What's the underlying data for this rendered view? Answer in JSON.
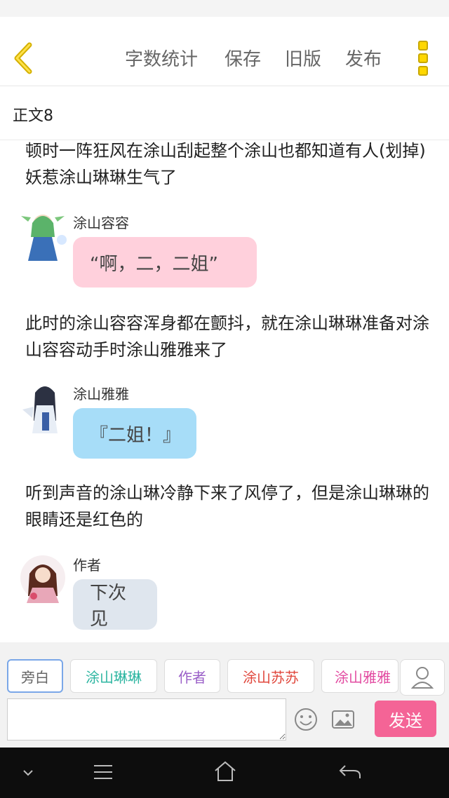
{
  "toolbar": {
    "word_count": "字数统计",
    "save": "保存",
    "old_version": "旧版",
    "publish": "发布"
  },
  "chapter": {
    "title": "正文8"
  },
  "content": {
    "narration_1": "顿时一阵狂风在涂山刮起整个涂山也都知道有人(划掉)妖惹涂山琳琳生气了",
    "msg_1": {
      "speaker": "涂山容容",
      "text": "“啊，二，二姐”"
    },
    "narration_2": "此时的涂山容容浑身都在颤抖，就在涂山琳琳准备对涂山容容动手时涂山雅雅来了",
    "msg_2": {
      "speaker": "涂山雅雅",
      "text": "『二姐！』"
    },
    "narration_3": "听到声音的涂山琳冷静下来了风停了，但是涂山琳琳的眼睛还是红色的",
    "msg_3": {
      "speaker": "作者",
      "text": "下次见"
    }
  },
  "role_chips": [
    {
      "label": "旁白",
      "color": "#666666"
    },
    {
      "label": "涂山琳琳",
      "color": "#2bb5a0"
    },
    {
      "label": "作者",
      "color": "#9a5fc8"
    },
    {
      "label": "涂山苏苏",
      "color": "#e0463b"
    },
    {
      "label": "涂山雅雅",
      "color": "#e24aa0"
    }
  ],
  "composer": {
    "input_value": "",
    "send_label": "发送"
  },
  "colors": {
    "send": "#f46496",
    "bubble_pink": "#ffd0dc",
    "bubble_blue": "#a7ddf8",
    "bubble_gray": "#dfe6ee"
  }
}
